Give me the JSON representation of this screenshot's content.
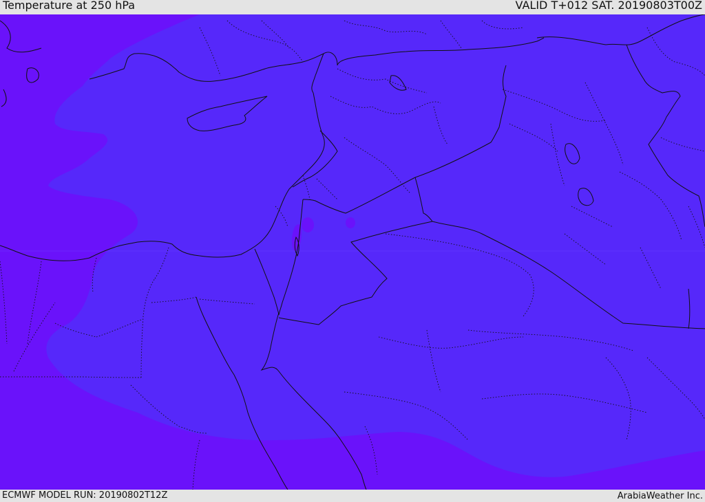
{
  "header": {
    "title": "Temperature at 250 hPa",
    "valid": "VALID T+012 SAT. 20190803T00Z"
  },
  "footer": {
    "model_run": "ECMWF MODEL RUN: 20190802T12Z",
    "credit": "ArabiaWeather Inc."
  },
  "map": {
    "colors": {
      "cold_band": "#6a12fa",
      "warmer_band": "#5628fa",
      "warm_spot": "#5f1cf4",
      "borders": "#111111"
    }
  }
}
